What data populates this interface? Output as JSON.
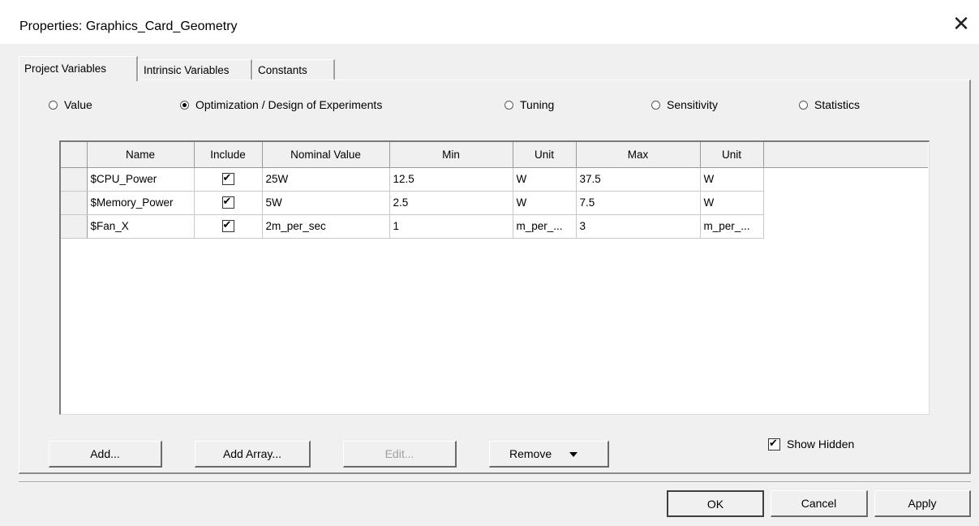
{
  "dialog": {
    "title": "Properties: Graphics_Card_Geometry",
    "close_label": "✕"
  },
  "tabs": [
    {
      "label": "Project Variables",
      "active": true
    },
    {
      "label": "Intrinsic Variables",
      "active": false
    },
    {
      "label": "Constants",
      "active": false
    }
  ],
  "modes": [
    {
      "label": "Value",
      "selected": false
    },
    {
      "label": "Optimization / Design of Experiments",
      "selected": true
    },
    {
      "label": "Tuning",
      "selected": false
    },
    {
      "label": "Sensitivity",
      "selected": false
    },
    {
      "label": "Statistics",
      "selected": false
    }
  ],
  "table": {
    "columns": [
      "Name",
      "Include",
      "Nominal Value",
      "Min",
      "Unit",
      "Max",
      "Unit"
    ],
    "rows": [
      {
        "name": "$CPU_Power",
        "include": true,
        "nominal": "25W",
        "min": "12.5",
        "min_unit": "W",
        "max": "37.5",
        "max_unit": "W"
      },
      {
        "name": "$Memory_Power",
        "include": true,
        "nominal": "5W",
        "min": "2.5",
        "min_unit": "W",
        "max": "7.5",
        "max_unit": "W"
      },
      {
        "name": "$Fan_X",
        "include": true,
        "nominal": "2m_per_sec",
        "min": "1",
        "min_unit": "m_per_...",
        "max": "3",
        "max_unit": "m_per_..."
      }
    ]
  },
  "buttons": {
    "add": "Add...",
    "add_array": "Add Array...",
    "edit": "Edit...",
    "remove": "Remove",
    "ok": "OK",
    "cancel": "Cancel",
    "apply": "Apply"
  },
  "show_hidden": {
    "label": "Show Hidden",
    "checked": true
  }
}
